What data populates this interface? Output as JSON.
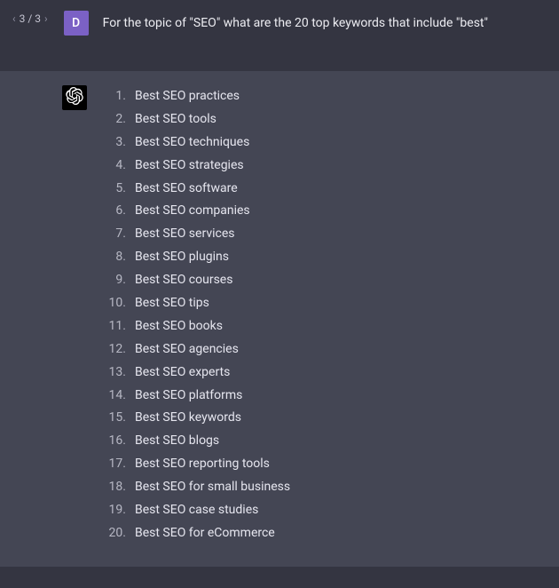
{
  "pager": {
    "current": 3,
    "total": 3,
    "display": "3 / 3"
  },
  "user": {
    "avatar_letter": "D",
    "message": "For the topic of  \"SEO\" what are the 20 top keywords that include \"best\""
  },
  "assistant": {
    "keywords": [
      "Best SEO practices",
      "Best SEO tools",
      "Best SEO techniques",
      "Best SEO strategies",
      "Best SEO software",
      "Best SEO companies",
      "Best SEO services",
      "Best SEO plugins",
      "Best SEO courses",
      "Best SEO tips",
      "Best SEO books",
      "Best SEO agencies",
      "Best SEO experts",
      "Best SEO platforms",
      "Best SEO keywords",
      "Best SEO blogs",
      "Best SEO reporting tools",
      "Best SEO for small business",
      "Best SEO case studies",
      "Best SEO for eCommerce"
    ]
  }
}
